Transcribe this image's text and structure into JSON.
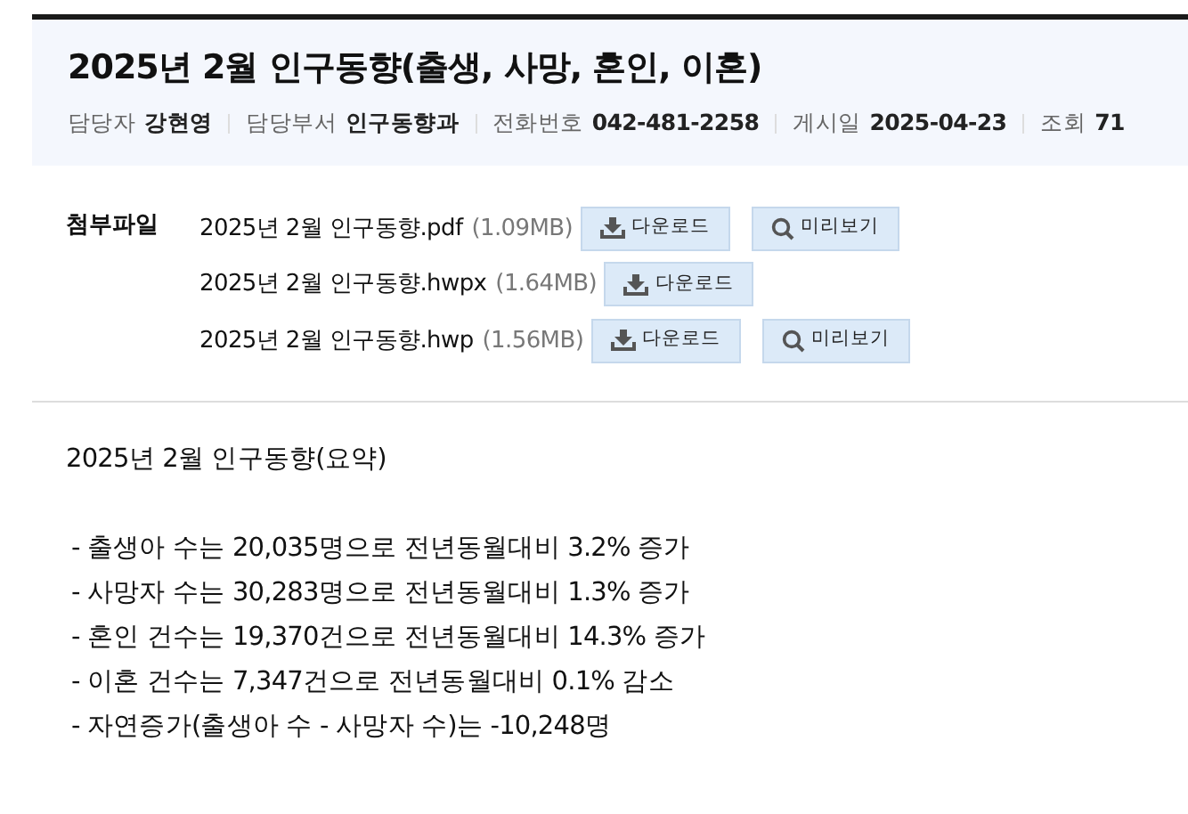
{
  "title": "2025년 2월 인구동향(출생, 사망, 혼인, 이혼)",
  "meta": [
    {
      "label": "담당자",
      "value": "강현영"
    },
    {
      "label": "담당부서",
      "value": "인구동향과"
    },
    {
      "label": "전화번호",
      "value": "042-481-2258"
    },
    {
      "label": "게시일",
      "value": "2025-04-23"
    },
    {
      "label": "조회",
      "value": "71"
    }
  ],
  "attachments": {
    "label": "첨부파일",
    "files": [
      {
        "name": "2025년 2월 인구동향.pdf",
        "size": "(1.09MB)",
        "buttons": [
          {
            "kind": "download",
            "label": "다운로드"
          },
          {
            "kind": "preview",
            "label": "미리보기"
          }
        ]
      },
      {
        "name": "2025년 2월 인구동향.hwpx",
        "size": "(1.64MB)",
        "buttons": [
          {
            "kind": "download",
            "label": "다운로드"
          }
        ]
      },
      {
        "name": "2025년 2월 인구동향.hwp",
        "size": "(1.56MB)",
        "buttons": [
          {
            "kind": "download",
            "label": "다운로드"
          },
          {
            "kind": "preview",
            "label": "미리보기"
          }
        ]
      }
    ]
  },
  "body": {
    "heading": "2025년 2월 인구동향(요약)",
    "lines": [
      "- 출생아 수는 20,035명으로 전년동월대비 3.2% 증가",
      "- 사망자 수는 30,283명으로 전년동월대비 1.3% 증가",
      "- 혼인 건수는 19,370건으로 전년동월대비 14.3% 증가",
      "- 이혼 건수는 7,347건으로 전년동월대비 0.1% 감소",
      "- 자연증가(출생아 수 - 사망자 수)는 -10,248명"
    ]
  }
}
